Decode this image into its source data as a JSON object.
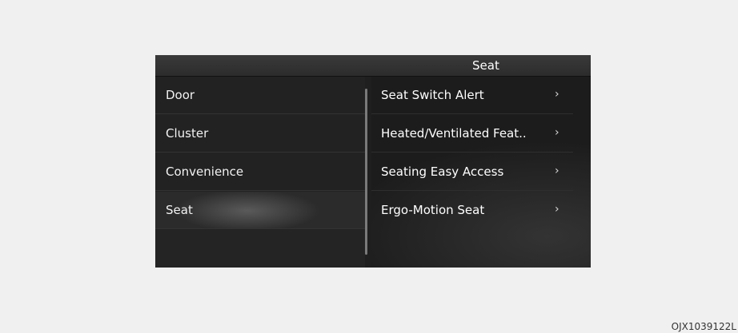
{
  "header": {
    "title": "Seat"
  },
  "left_menu": {
    "items": [
      {
        "label": "Door"
      },
      {
        "label": "Cluster"
      },
      {
        "label": "Convenience"
      },
      {
        "label": "Seat"
      }
    ],
    "selected": "Seat"
  },
  "right_menu": {
    "chevron": "›",
    "items": [
      {
        "label": "Seat Switch Alert"
      },
      {
        "label": "Heated/Ventilated Feat.."
      },
      {
        "label": "Seating Easy Access"
      },
      {
        "label": "Ergo-Motion Seat"
      }
    ]
  },
  "footer": {
    "code": "OJX1039122L"
  }
}
